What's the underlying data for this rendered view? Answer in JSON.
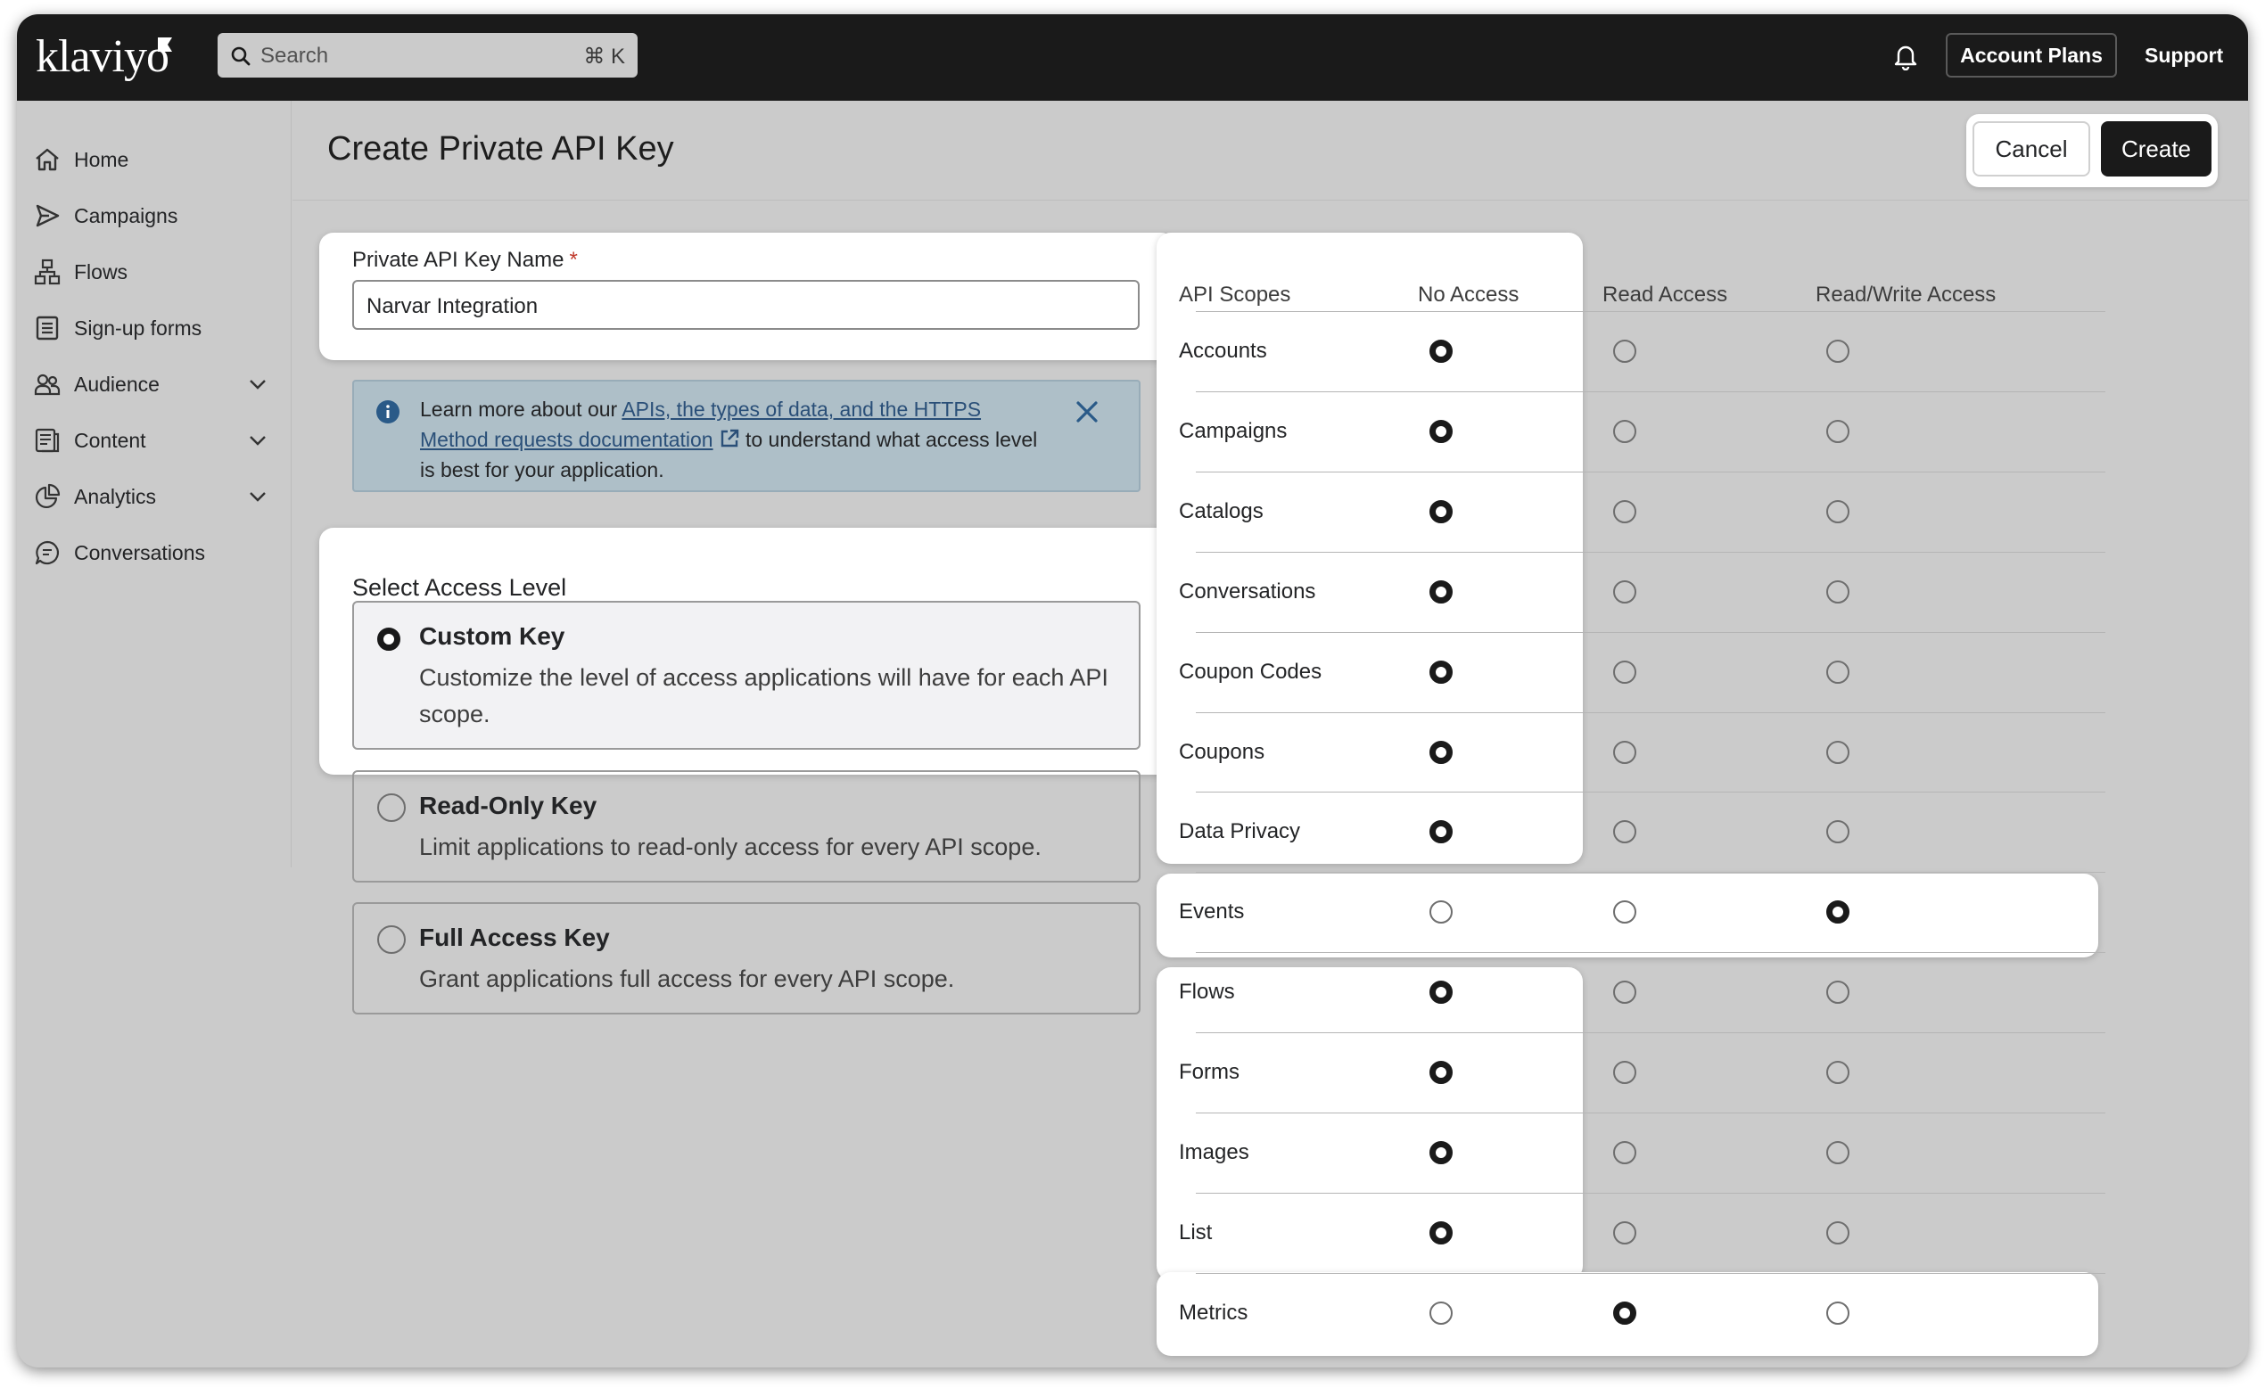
{
  "app": {
    "logo": "klaviyo"
  },
  "topbar": {
    "search_placeholder": "Search",
    "search_shortcut": "⌘ K",
    "account_plans": "Account Plans",
    "support": "Support",
    "bell_icon": "bell-icon"
  },
  "sidebar": {
    "items": [
      {
        "label": "Home",
        "icon": "home-icon",
        "expandable": false
      },
      {
        "label": "Campaigns",
        "icon": "send-icon",
        "expandable": false
      },
      {
        "label": "Flows",
        "icon": "flows-icon",
        "expandable": false
      },
      {
        "label": "Sign-up forms",
        "icon": "form-icon",
        "expandable": false
      },
      {
        "label": "Audience",
        "icon": "users-icon",
        "expandable": true
      },
      {
        "label": "Content",
        "icon": "content-icon",
        "expandable": true
      },
      {
        "label": "Analytics",
        "icon": "pie-chart-icon",
        "expandable": true
      },
      {
        "label": "Conversations",
        "icon": "chat-icon",
        "expandable": false
      }
    ]
  },
  "page": {
    "title": "Create Private API Key",
    "cancel_label": "Cancel",
    "create_label": "Create"
  },
  "name_field": {
    "label": "Private API Key Name",
    "required_mark": "*",
    "value": "Narvar Integration"
  },
  "info_banner": {
    "text_before": "Learn more about our ",
    "link_text": "APIs, the types of data, and the HTTPS Method requests documentation",
    "text_after": " to understand what access level is best for your application."
  },
  "access_level": {
    "label": "Select Access Level",
    "options": [
      {
        "title": "Custom Key",
        "description": "Customize the level of access applications will have for each API scope.",
        "selected": true
      },
      {
        "title": "Read-Only Key",
        "description": "Limit applications to read-only access for every API scope.",
        "selected": false
      },
      {
        "title": "Full Access Key",
        "description": "Grant applications full access for every API scope.",
        "selected": false
      }
    ]
  },
  "scopes": {
    "headers": [
      "API Scopes",
      "No Access",
      "Read Access",
      "Read/Write Access"
    ],
    "rows": [
      {
        "name": "Accounts",
        "access": "No Access"
      },
      {
        "name": "Campaigns",
        "access": "No Access"
      },
      {
        "name": "Catalogs",
        "access": "No Access"
      },
      {
        "name": "Conversations",
        "access": "No Access"
      },
      {
        "name": "Coupon Codes",
        "access": "No Access"
      },
      {
        "name": "Coupons",
        "access": "No Access"
      },
      {
        "name": "Data Privacy",
        "access": "No Access"
      },
      {
        "name": "Events",
        "access": "Read/Write Access"
      },
      {
        "name": "Flows",
        "access": "No Access"
      },
      {
        "name": "Forms",
        "access": "No Access"
      },
      {
        "name": "Images",
        "access": "No Access"
      },
      {
        "name": "List",
        "access": "No Access"
      },
      {
        "name": "Metrics",
        "access": "Read Access"
      }
    ]
  },
  "colors": {
    "topbar": "#1a1a1a",
    "overlay": "#cbcbcb",
    "info_banner": "#aebfc8",
    "link": "#2a4f78",
    "required": "#c0392b"
  }
}
